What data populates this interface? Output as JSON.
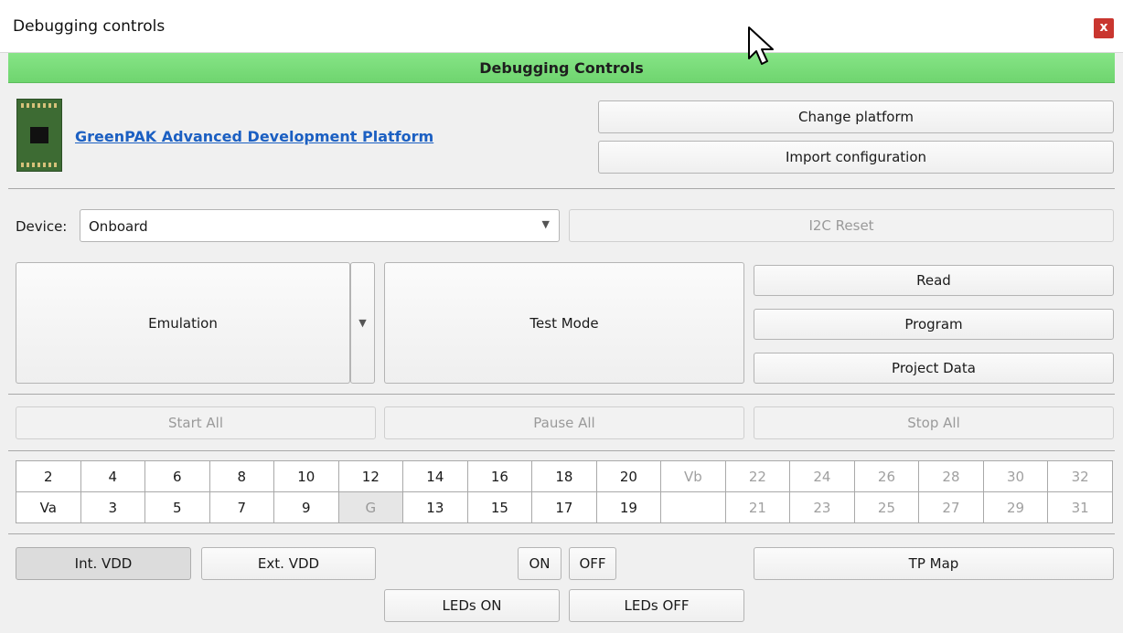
{
  "window": {
    "title": "Debugging controls",
    "close_label": "x"
  },
  "header": {
    "title": "Debugging Controls"
  },
  "platform": {
    "link_text": "GreenPAK Advanced Development Platform",
    "change_platform": "Change platform",
    "import_configuration": "Import configuration"
  },
  "device": {
    "label": "Device:",
    "selected": "Onboard",
    "i2c_reset": "I2C Reset"
  },
  "modes": {
    "emulation": "Emulation",
    "test_mode": "Test Mode",
    "read": "Read",
    "program": "Program",
    "project_data": "Project Data"
  },
  "run": {
    "start_all": "Start All",
    "pause_all": "Pause All",
    "stop_all": "Stop All"
  },
  "pins": {
    "top": [
      "2",
      "4",
      "6",
      "8",
      "10",
      "12",
      "14",
      "16",
      "18",
      "20",
      "Vb",
      "22",
      "24",
      "26",
      "28",
      "30",
      "32"
    ],
    "bottom": [
      "Va",
      "3",
      "5",
      "7",
      "9",
      "G",
      "13",
      "15",
      "17",
      "19",
      "",
      "21",
      "23",
      "25",
      "27",
      "29",
      "31"
    ]
  },
  "power": {
    "int_vdd": "Int. VDD",
    "ext_vdd": "Ext. VDD",
    "on": "ON",
    "off": "OFF",
    "tp_map": "TP Map",
    "leds_on": "LEDs ON",
    "leds_off": "LEDs OFF"
  }
}
